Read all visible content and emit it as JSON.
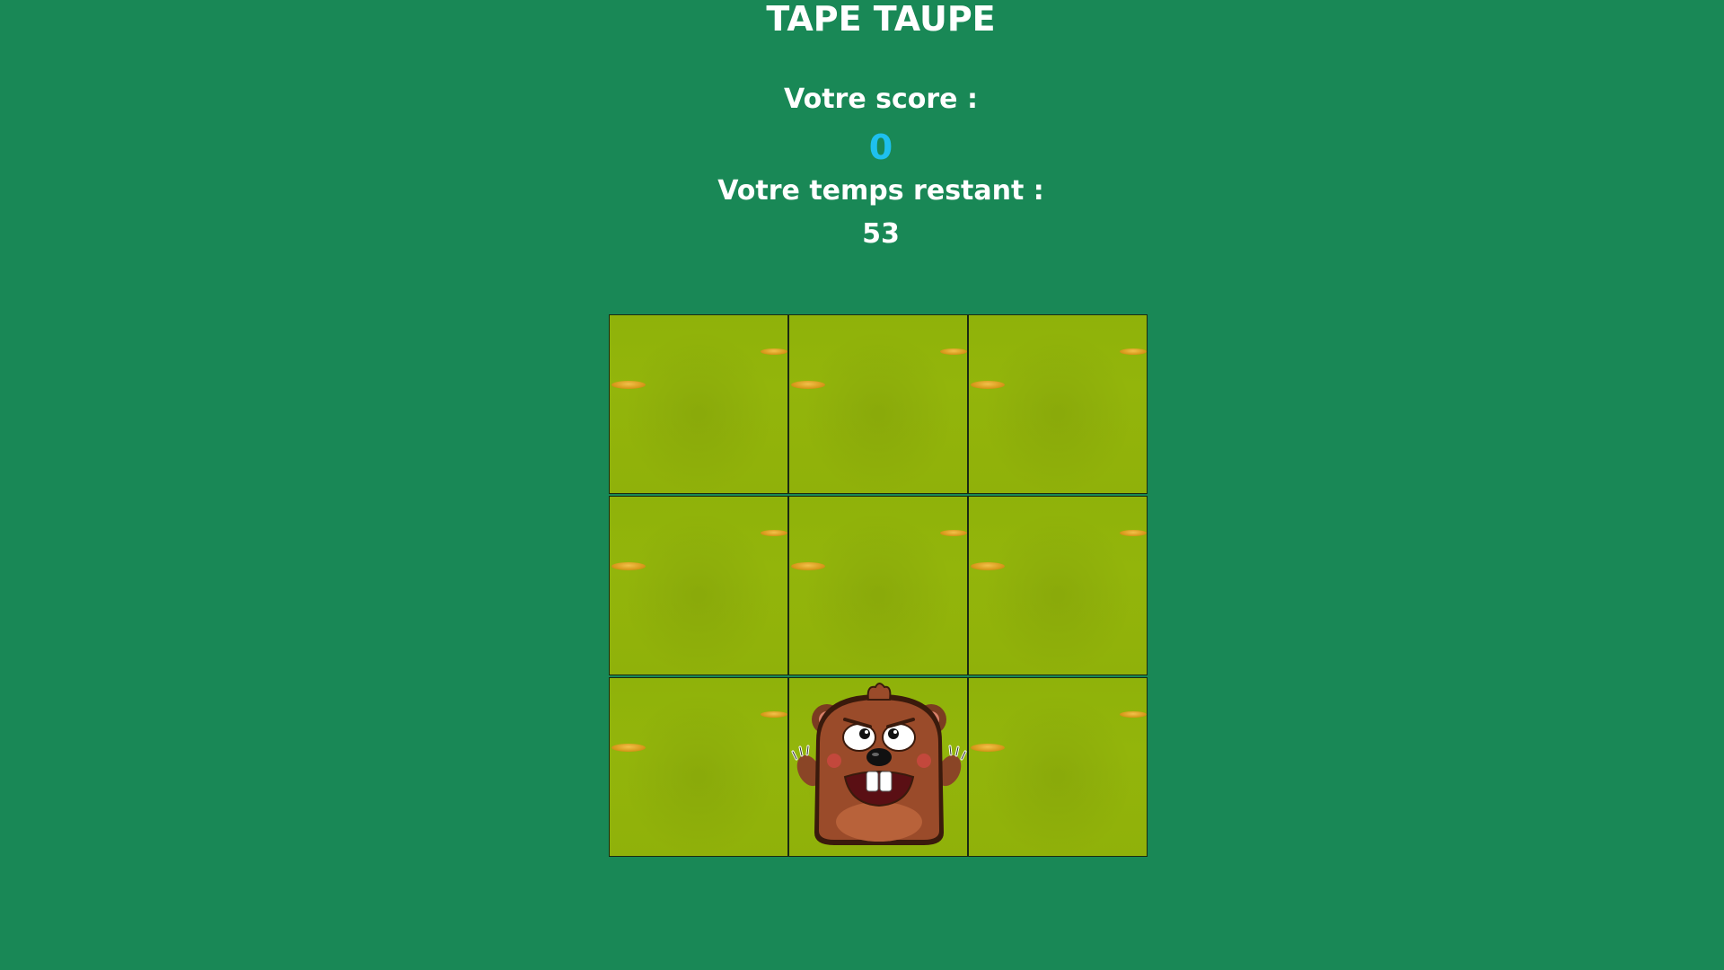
{
  "game": {
    "title": "TAPE TAUPE",
    "score_label": "Votre score :",
    "score": "0",
    "time_label": "Votre temps restant :",
    "time_remaining": "53"
  },
  "board": {
    "rows": 3,
    "cols": 3,
    "mole_cell": 7
  },
  "colors": {
    "background": "#198856",
    "score": "#1ec0ee",
    "grass": "#8fb20a"
  }
}
